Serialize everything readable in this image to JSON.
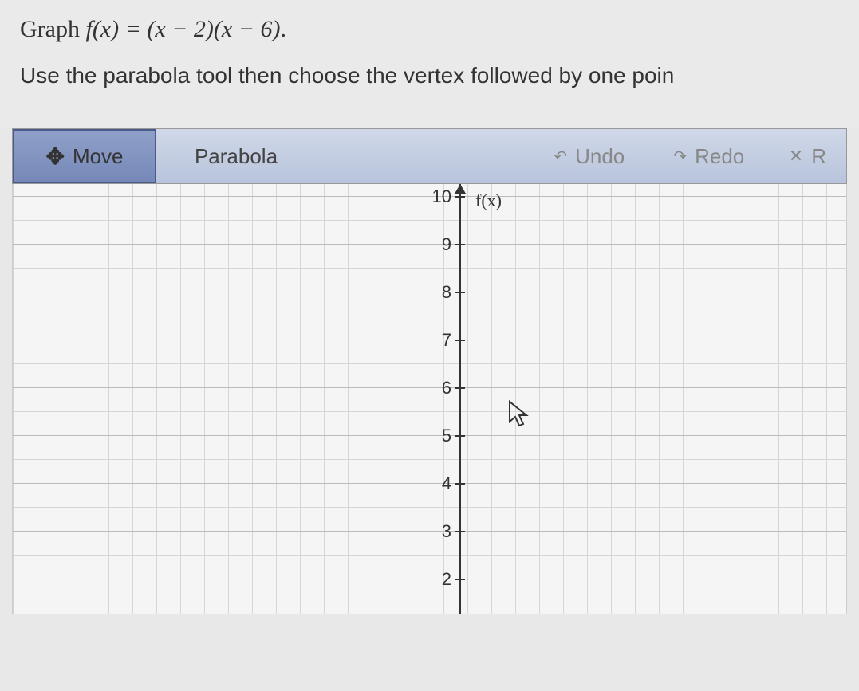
{
  "question": {
    "prefix": "Graph ",
    "function": "f(x) = (x − 2)(x − 6)",
    "suffix": "."
  },
  "instruction": "Use the parabola tool then choose the vertex followed by one poin",
  "toolbar": {
    "move": "Move",
    "parabola": "Parabola",
    "undo": "Undo",
    "redo": "Redo",
    "reset": "R"
  },
  "graph": {
    "y_axis_title": "f(x)",
    "y_ticks": [
      {
        "value": "10",
        "pos": 15
      },
      {
        "value": "9",
        "pos": 75
      },
      {
        "value": "8",
        "pos": 135
      },
      {
        "value": "7",
        "pos": 195
      },
      {
        "value": "6",
        "pos": 255
      },
      {
        "value": "5",
        "pos": 315
      },
      {
        "value": "4",
        "pos": 375
      },
      {
        "value": "3",
        "pos": 435
      },
      {
        "value": "2",
        "pos": 495
      }
    ]
  }
}
